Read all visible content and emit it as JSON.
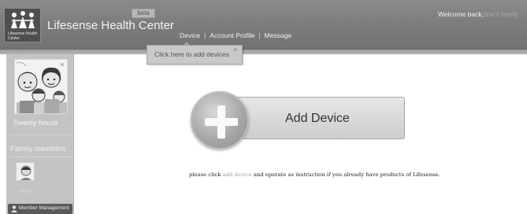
{
  "header": {
    "logo_text": "Lifesense Health Center",
    "app_title": "Lifesense Health Center",
    "beta_label": "beta",
    "welcome_prefix": "Welcome back,",
    "welcome_user": "tina's family",
    "nav": {
      "device": "Device",
      "account_profile": "Account Profile",
      "message": "Message",
      "separator": "|"
    }
  },
  "tooltip": {
    "text": "Click here to add devices",
    "close": "×"
  },
  "sidebar": {
    "family_name": "Sweety house",
    "members_heading": "Family members",
    "members": [
      {
        "name": "terry"
      }
    ],
    "manage_button": "Member Management"
  },
  "main": {
    "add_device_label": "Add Device",
    "instruction_prefix": "please click",
    "instruction_link": "add device",
    "instruction_suffix": "and operate as instruction if you already have products of Lifesense."
  },
  "colors": {
    "header_bg": "#7b7b7b",
    "sidebar_bg": "#c3c3c3",
    "accent_link": "#9c9c9c"
  }
}
